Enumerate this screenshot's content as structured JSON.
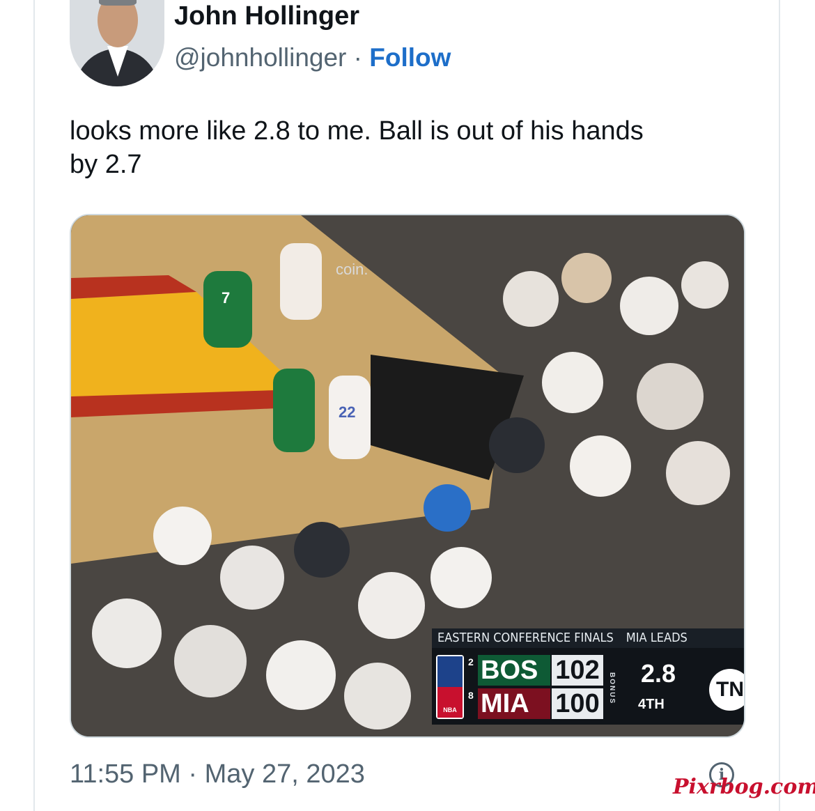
{
  "tweet": {
    "author_name": "John Hollinger",
    "handle": "@johnhollinger",
    "separator": " · ",
    "follow_label": "Follow",
    "text_line1": "looks more like 2.8 to me. Ball is out of his hands",
    "text_line2": "by 2.7",
    "timestamp": "11:55 PM · May 27, 2023",
    "colors": {
      "follow": "#1d6ec9",
      "name": "#0f1419",
      "muted": "#536471"
    }
  },
  "media": {
    "court_text": {
      "sponsor": "coin."
    },
    "jersey_numbers": [
      "7",
      "22"
    ],
    "scoreboard": {
      "series_label": "EASTERN CONFERENCE FINALS",
      "series_status": "MIA LEADS",
      "league_logo_text": "NBA",
      "teams": [
        {
          "seed": "2",
          "abbr": "BOS",
          "score": "102",
          "color": "#0e5a35"
        },
        {
          "seed": "8",
          "abbr": "MIA",
          "score": "100",
          "color": "#7c1020"
        }
      ],
      "bonus_label": "BONUS",
      "clock": "2.8",
      "period": "4TH",
      "network_logo": "TN"
    }
  },
  "icons": {
    "info": "info-icon"
  },
  "watermark": "Pixrbog.com"
}
